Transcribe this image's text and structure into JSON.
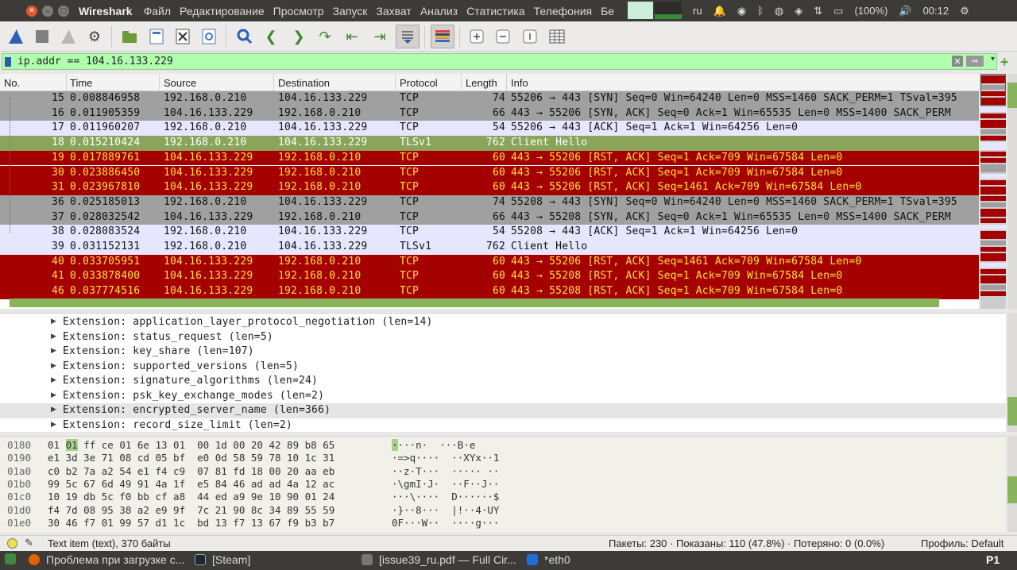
{
  "topbar": {
    "app_name": "Wireshark",
    "menu": [
      "Файл",
      "Редактирование",
      "Просмотр",
      "Запуск",
      "Захват",
      "Анализ",
      "Статистика",
      "Телефония",
      "Бе"
    ],
    "tray": {
      "keyboard": "ru",
      "battery": "(100%)",
      "clock": "00:12",
      "icons": [
        "notification-bell-icon",
        "steam-icon",
        "bluetooth-icon",
        "chrome-icon",
        "nvidia-icon",
        "network-icon",
        "battery-icon",
        "volume-icon",
        "settings-gear-icon"
      ]
    }
  },
  "toolbar": {
    "buttons": [
      "shark-fin-start-icon",
      "stop-square-icon",
      "restart-fin-icon",
      "capture-options-gear-icon",
      "open-folder-icon",
      "save-file-icon",
      "close-file-icon",
      "reload-icon",
      "find-packet-icon",
      "go-back-icon",
      "go-forward-icon",
      "go-to-packet-icon",
      "go-first-icon",
      "go-last-icon",
      "autoscroll-icon",
      "colorize-icon",
      "zoom-in-icon",
      "zoom-out-icon",
      "normal-size-icon",
      "resize-columns-icon"
    ]
  },
  "filter": {
    "value": "ip.addr == 104.16.133.229",
    "clear_icon": "✕",
    "apply_icon": "⇒",
    "dropdown_icon": "▾",
    "add_icon": "+"
  },
  "packet_list": {
    "columns": [
      "No.",
      "Time",
      "Source",
      "Destination",
      "Protocol",
      "Length",
      "Info"
    ],
    "rows": [
      {
        "no": "15",
        "time": "0.008846958",
        "src": "192.168.0.210",
        "dst": "104.16.133.229",
        "proto": "TCP",
        "len": "74",
        "info": "55206 → 443 [SYN] Seq=0 Win=64240 Len=0 MSS=1460 SACK_PERM=1 TSval=395",
        "style": "gray"
      },
      {
        "no": "16",
        "time": "0.011905359",
        "src": "104.16.133.229",
        "dst": "192.168.0.210",
        "proto": "TCP",
        "len": "66",
        "info": "443 → 55206 [SYN, ACK] Seq=0 Ack=1 Win=65535 Len=0 MSS=1400 SACK_PERM",
        "style": "gray"
      },
      {
        "no": "17",
        "time": "0.011960207",
        "src": "192.168.0.210",
        "dst": "104.16.133.229",
        "proto": "TCP",
        "len": "54",
        "info": "55206 → 443 [ACK] Seq=1 Ack=1 Win=64256 Len=0",
        "style": "lav"
      },
      {
        "no": "18",
        "time": "0.015210424",
        "src": "192.168.0.210",
        "dst": "104.16.133.229",
        "proto": "TLSv1",
        "len": "762",
        "info": "Client Hello",
        "style": "selected"
      },
      {
        "no": "19",
        "time": "0.017889761",
        "src": "104.16.133.229",
        "dst": "192.168.0.210",
        "proto": "TCP",
        "len": "60",
        "info": "443 → 55206 [RST, ACK] Seq=1 Ack=709 Win=67584 Len=0",
        "style": "red"
      },
      {
        "no": "30",
        "time": "0.023886450",
        "src": "104.16.133.229",
        "dst": "192.168.0.210",
        "proto": "TCP",
        "len": "60",
        "info": "443 → 55206 [RST, ACK] Seq=1 Ack=709 Win=67584 Len=0",
        "style": "red"
      },
      {
        "no": "31",
        "time": "0.023967810",
        "src": "104.16.133.229",
        "dst": "192.168.0.210",
        "proto": "TCP",
        "len": "60",
        "info": "443 → 55206 [RST, ACK] Seq=1461 Ack=709 Win=67584 Len=0",
        "style": "red"
      },
      {
        "no": "36",
        "time": "0.025185013",
        "src": "192.168.0.210",
        "dst": "104.16.133.229",
        "proto": "TCP",
        "len": "74",
        "info": "55208 → 443 [SYN] Seq=0 Win=64240 Len=0 MSS=1460 SACK_PERM=1 TSval=395",
        "style": "gray"
      },
      {
        "no": "37",
        "time": "0.028032542",
        "src": "104.16.133.229",
        "dst": "192.168.0.210",
        "proto": "TCP",
        "len": "66",
        "info": "443 → 55208 [SYN, ACK] Seq=0 Ack=1 Win=65535 Len=0 MSS=1400 SACK_PERM",
        "style": "gray"
      },
      {
        "no": "38",
        "time": "0.028083524",
        "src": "192.168.0.210",
        "dst": "104.16.133.229",
        "proto": "TCP",
        "len": "54",
        "info": "55208 → 443 [ACK] Seq=1 Ack=1 Win=64256 Len=0",
        "style": "lav"
      },
      {
        "no": "39",
        "time": "0.031152131",
        "src": "192.168.0.210",
        "dst": "104.16.133.229",
        "proto": "TLSv1",
        "len": "762",
        "info": "Client Hello",
        "style": "lav"
      },
      {
        "no": "40",
        "time": "0.033705951",
        "src": "104.16.133.229",
        "dst": "192.168.0.210",
        "proto": "TCP",
        "len": "60",
        "info": "443 → 55206 [RST, ACK] Seq=1461 Ack=709 Win=67584 Len=0",
        "style": "red"
      },
      {
        "no": "41",
        "time": "0.033878400",
        "src": "104.16.133.229",
        "dst": "192.168.0.210",
        "proto": "TCP",
        "len": "60",
        "info": "443 → 55208 [RST, ACK] Seq=1 Ack=709 Win=67584 Len=0",
        "style": "red"
      },
      {
        "no": "46",
        "time": "0.037774516",
        "src": "104.16.133.229",
        "dst": "192.168.0.210",
        "proto": "TCP",
        "len": "60",
        "info": "443 → 55208 [RST, ACK] Seq=1 Ack=709 Win=67584 Len=0",
        "style": "red"
      }
    ]
  },
  "details": {
    "expand_icon": "▶",
    "items": [
      "Extension: application_layer_protocol_negotiation (len=14)",
      "Extension: status_request (len=5)",
      "Extension: key_share (len=107)",
      "Extension: supported_versions (len=5)",
      "Extension: signature_algorithms (len=24)",
      "Extension: psk_key_exchange_modes (len=2)",
      "Extension: encrypted_server_name (len=366)",
      "Extension: record_size_limit (len=2)"
    ],
    "selected_index": 6
  },
  "bytes": {
    "rows": [
      {
        "offset": "0180",
        "hex_pre": "01 ",
        "hex_hl": "01",
        "hex_post": " ff ce 01 6e 13 01  00 1d 00 20 42 89 b8 65",
        "ascii_hl": "·",
        "ascii_post": "···n·  ···B·e"
      },
      {
        "offset": "0190",
        "hex_pre": "e1 3d 3e 71 08 cd 05 bf  e0 0d 58 59 78 10 1c 31",
        "hex_hl": "",
        "hex_post": "",
        "ascii_hl": "",
        "ascii_post": "·=>q····  ··XYx··1"
      },
      {
        "offset": "01a0",
        "hex_pre": "c0 b2 7a a2 54 e1 f4 c9  07 81 fd 18 00 20 aa eb",
        "hex_hl": "",
        "hex_post": "",
        "ascii_hl": "",
        "ascii_post": "··z·T···  ····· ··"
      },
      {
        "offset": "01b0",
        "hex_pre": "99 5c 67 6d 49 91 4a 1f  e5 84 46 ad ad 4a 12 ac",
        "hex_hl": "",
        "hex_post": "",
        "ascii_hl": "",
        "ascii_post": "·\\gmI·J·  ··F··J··"
      },
      {
        "offset": "01c0",
        "hex_pre": "10 19 db 5c f0 bb cf a8  44 ed a9 9e 10 90 01 24",
        "hex_hl": "",
        "hex_post": "",
        "ascii_hl": "",
        "ascii_post": "···\\····  D······$"
      },
      {
        "offset": "01d0",
        "hex_pre": "f4 7d 08 95 38 a2 e9 9f  7c 21 90 8c 34 89 55 59",
        "hex_hl": "",
        "hex_post": "",
        "ascii_hl": "",
        "ascii_post": "·}··8···  |!··4·UY"
      },
      {
        "offset": "01e0",
        "hex_pre": "30 46 f7 01 99 57 d1 1c  bd 13 f7 13 67 f9 b3 b7",
        "hex_hl": "",
        "hex_post": "",
        "ascii_hl": "",
        "ascii_post": "0F···W··  ····g···"
      }
    ]
  },
  "status": {
    "text": "Text item (text), 370 байты",
    "stats": "Пакеты: 230 · Показаны: 110 (47.8%) · Потеряно: 0 (0.0%)",
    "profile": "Профиль: Default"
  },
  "taskbar": {
    "tasks": [
      {
        "label": "Проблема при загрузке с...",
        "icon": "firefox-icon",
        "color": "#e66000"
      },
      {
        "label": "[Steam]",
        "icon": "steam-icon",
        "color": "#1b2838"
      },
      {
        "label": "[issue39_ru.pdf — Full Cir...",
        "icon": "pdf-viewer-icon",
        "color": "#777777"
      },
      {
        "label": "*eth0",
        "icon": "wireshark-icon",
        "color": "#1e6fd6"
      }
    ],
    "workspace": "P1"
  },
  "colors": {
    "row_gray": "#a0a0a0",
    "row_lav": "#e7e6ff",
    "row_red": "#a40000",
    "row_selected": "#8aa55b",
    "filter_valid": "#afffaf",
    "hex_highlight": "#a5d18a"
  }
}
